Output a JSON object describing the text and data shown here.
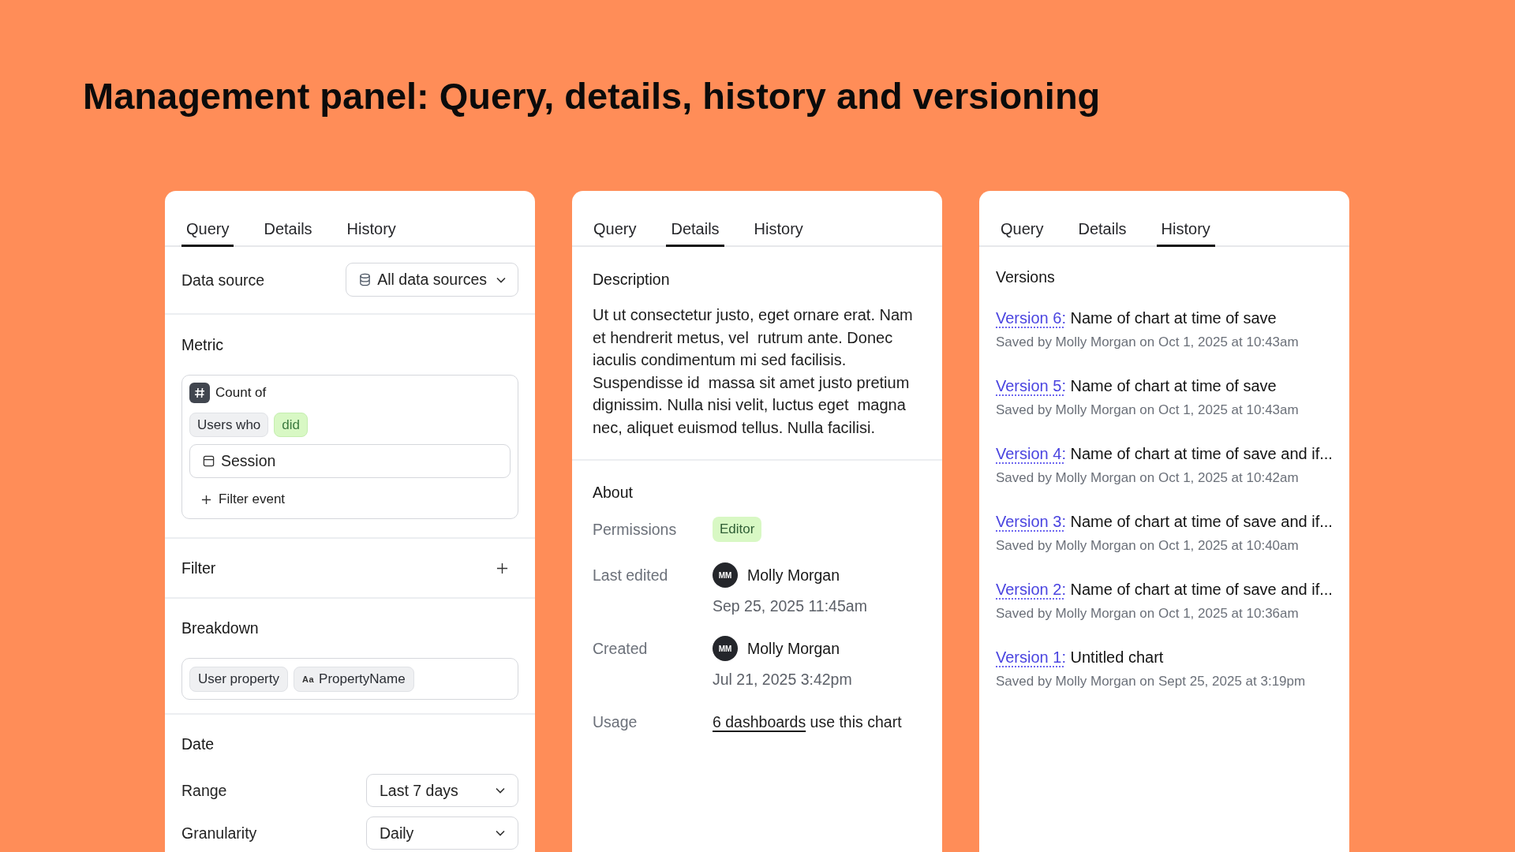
{
  "title": "Management panel: Query, details, history and versioning",
  "panels": [
    {
      "kind": "query",
      "tabs": [
        {
          "label": "Query",
          "selected": true
        },
        {
          "label": "Details",
          "selected": false
        },
        {
          "label": "History",
          "selected": false
        }
      ],
      "data_source": {
        "label": "Data source",
        "value": "All data sources"
      },
      "metric": {
        "label": "Metric",
        "count_label": "Count of",
        "chips": [
          {
            "text": "Users who",
            "kind": "neutral"
          },
          {
            "text": "did",
            "kind": "positive"
          }
        ],
        "event": "Session",
        "add_filter": "Filter event"
      },
      "filter": {
        "label": "Filter"
      },
      "breakdown": {
        "label": "Breakdown",
        "chips": [
          {
            "text": "User property"
          },
          {
            "glyph": "Aa",
            "text": "PropertyName"
          }
        ]
      },
      "date": {
        "label": "Date",
        "rows": [
          {
            "label": "Range",
            "value": "Last 7 days"
          },
          {
            "label": "Granularity",
            "value": "Daily"
          }
        ]
      }
    },
    {
      "kind": "details",
      "tabs": [
        {
          "label": "Query",
          "selected": false
        },
        {
          "label": "Details",
          "selected": true
        },
        {
          "label": "History",
          "selected": false
        }
      ],
      "description": {
        "label": "Description",
        "text": "Ut ut consectetur justo, eget ornare erat. Nam et hendrerit metus, vel  rutrum ante. Donec iaculis condimentum mi sed facilisis. Suspendisse id  massa sit amet justo pretium dignissim. Nulla nisi velit, luctus eget  magna nec, aliquet euismod tellus. Nulla facilisi."
      },
      "about": {
        "label": "About",
        "rows": [
          {
            "kind": "badge",
            "label": "Permissions",
            "value": "Editor"
          },
          {
            "kind": "person",
            "label": "Last edited",
            "initials": "MM",
            "name": "Molly Morgan",
            "date": "Sep 25, 2025 11:45am"
          },
          {
            "kind": "person",
            "label": "Created",
            "initials": "MM",
            "name": "Molly Morgan",
            "date": "Jul 21, 2025 3:42pm"
          },
          {
            "kind": "link",
            "label": "Usage",
            "link": "6 dashboards",
            "text": "use this chart"
          }
        ]
      }
    },
    {
      "kind": "history",
      "tabs": [
        {
          "label": "Query",
          "selected": false
        },
        {
          "label": "Details",
          "selected": false
        },
        {
          "label": "History",
          "selected": true
        }
      ],
      "versions": {
        "label": "Versions",
        "items": [
          {
            "version": "Version 6:",
            "name": "Name of chart at time of save",
            "meta": "Saved by Molly Morgan on Oct 1, 2025 at 10:43am"
          },
          {
            "version": "Version 5:",
            "name": "Name of chart at time of save",
            "meta": "Saved by Molly Morgan on Oct 1, 2025 at 10:43am"
          },
          {
            "version": "Version 4:",
            "name": "Name of chart at time of save and if...",
            "meta": "Saved by Molly Morgan on Oct 1, 2025 at 10:42am"
          },
          {
            "version": "Version 3:",
            "name": "Name of chart at time of save and if...",
            "meta": "Saved by Molly Morgan on Oct 1, 2025 at 10:40am"
          },
          {
            "version": "Version 2:",
            "name": "Name of chart at time of save and if...",
            "meta": "Saved by Molly Morgan on Oct 1, 2025 at 10:36am"
          },
          {
            "version": "Version 1:",
            "name": "Untitled chart",
            "meta": "Saved by Molly Morgan on Sept 25, 2025 at 3:19pm"
          }
        ]
      }
    }
  ]
}
